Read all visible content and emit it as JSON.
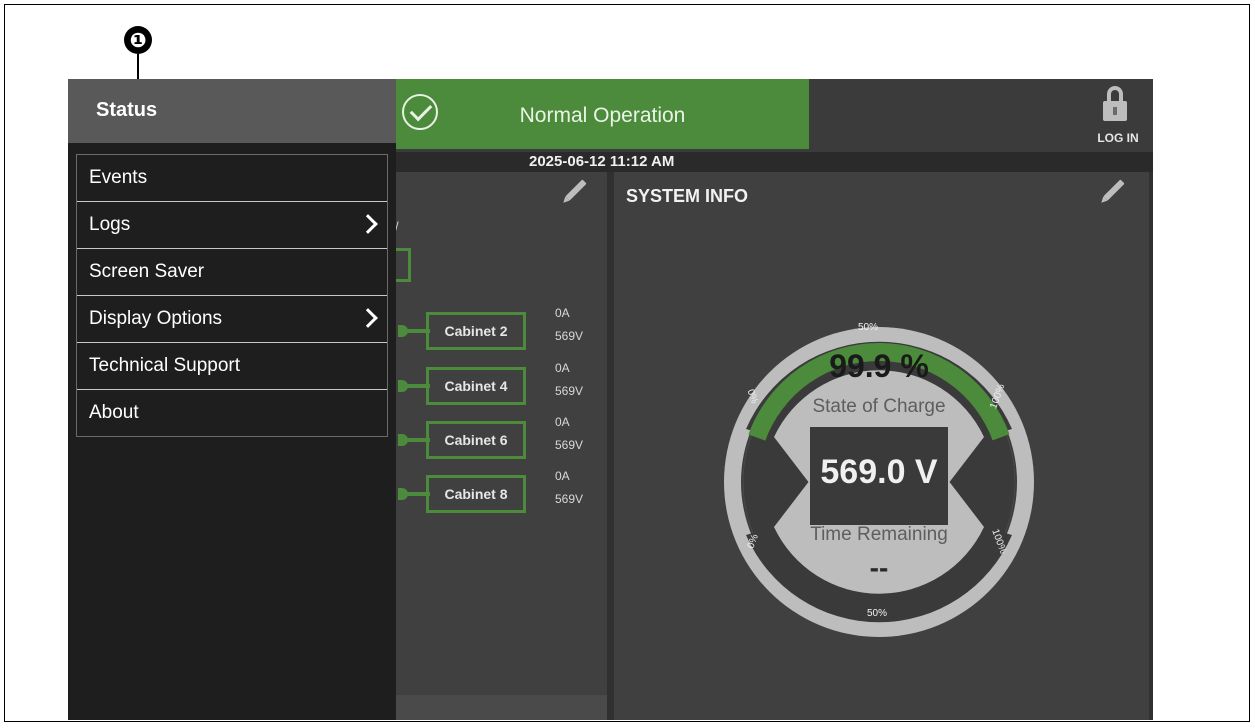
{
  "callout": {
    "number": "❶"
  },
  "status_bar": {
    "state_text": "Normal Operation",
    "datetime": "2025-06-12 11:12 AM",
    "login_label": "LOG IN",
    "state_color": "#4b8b3b"
  },
  "side_menu": {
    "title": "Status",
    "items": [
      {
        "label": "Events",
        "has_submenu": false
      },
      {
        "label": "Logs",
        "has_submenu": true
      },
      {
        "label": "Screen Saver",
        "has_submenu": false
      },
      {
        "label": "Display Options",
        "has_submenu": true
      },
      {
        "label": "Technical Support",
        "has_submenu": false
      },
      {
        "label": "About",
        "has_submenu": false
      }
    ]
  },
  "cabinets": [
    {
      "name": "Cabinet 2",
      "current": "0A",
      "voltage": "569V"
    },
    {
      "name": "Cabinet 4",
      "current": "0A",
      "voltage": "569V"
    },
    {
      "name": "Cabinet 6",
      "current": "0A",
      "voltage": "569V"
    },
    {
      "name": "Cabinet 8",
      "current": "0A",
      "voltage": "569V"
    }
  ],
  "system_info": {
    "title": "SYSTEM INFO",
    "state_of_charge_value": "99.9 %",
    "state_of_charge_label": "State of Charge",
    "state_of_charge_fraction": 0.999,
    "voltage": "569.0 V",
    "time_remaining_label": "Time Remaining",
    "time_remaining_value": "--",
    "gauge_ticks": {
      "top_left": "0%",
      "top_mid": "50%",
      "top_right": "100%",
      "bottom_left": "0%",
      "bottom_mid": "50%",
      "bottom_right": "100%"
    }
  }
}
